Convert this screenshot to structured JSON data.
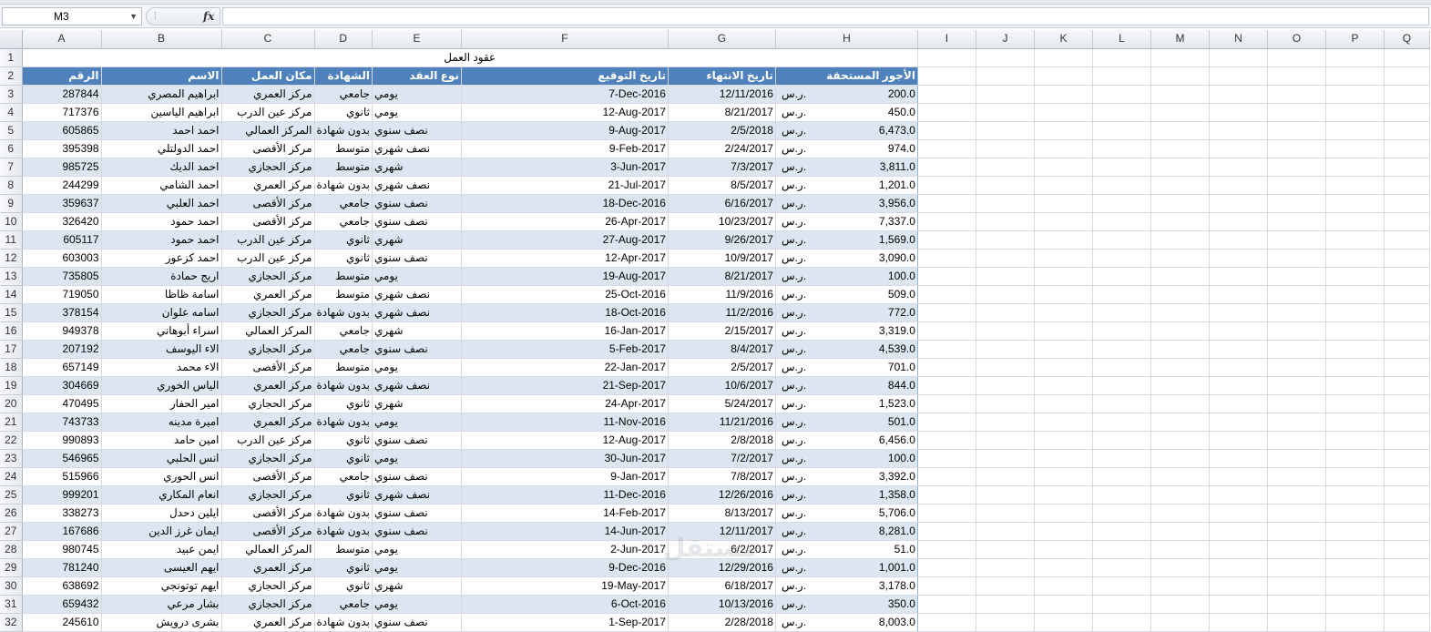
{
  "name_box": {
    "value": "M3"
  },
  "formula_bar": {
    "fx_label": "fx",
    "value": ""
  },
  "columns": [
    "A",
    "B",
    "C",
    "D",
    "E",
    "F",
    "G",
    "H",
    "I",
    "J",
    "K",
    "L",
    "M",
    "N",
    "O",
    "P",
    "Q"
  ],
  "title": "عقود العمل",
  "headers": {
    "A": "الرقم",
    "B": "الاسم",
    "C": "مكان العمل",
    "D": "الشهادة",
    "E": "نوع العقد",
    "F": "تاريخ التوقيع",
    "G": "تاريخ الانتهاء",
    "H": "الأجور المستحقة"
  },
  "currency_symbol": "ر.س.",
  "rows": [
    {
      "id": "287844",
      "name": "ابراهيم المصري",
      "place": "مركز العمري",
      "degree": "جامعي",
      "contract": "يومي",
      "sign": "7-Dec-2016",
      "end": "12/11/2016",
      "wage": "200.0"
    },
    {
      "id": "717376",
      "name": "ابراهيم الياسين",
      "place": "مركز عين الدرب",
      "degree": "ثانوي",
      "contract": "يومي",
      "sign": "12-Aug-2017",
      "end": "8/21/2017",
      "wage": "450.0"
    },
    {
      "id": "605865",
      "name": "احمد احمد",
      "place": "المركز العمالي",
      "degree": "بدون شهادة",
      "contract": "نصف سنوي",
      "sign": "9-Aug-2017",
      "end": "2/5/2018",
      "wage": "6,473.0"
    },
    {
      "id": "395398",
      "name": "احمد الدولتلي",
      "place": "مركز الأقصى",
      "degree": "متوسط",
      "contract": "نصف شهري",
      "sign": "9-Feb-2017",
      "end": "2/24/2017",
      "wage": "974.0"
    },
    {
      "id": "985725",
      "name": "احمد الديك",
      "place": "مركز الحجازي",
      "degree": "متوسط",
      "contract": "شهري",
      "sign": "3-Jun-2017",
      "end": "7/3/2017",
      "wage": "3,811.0"
    },
    {
      "id": "244299",
      "name": "احمد الشامي",
      "place": "مركز العمري",
      "degree": "بدون شهادة",
      "contract": "نصف شهري",
      "sign": "21-Jul-2017",
      "end": "8/5/2017",
      "wage": "1,201.0"
    },
    {
      "id": "359637",
      "name": "احمد العلبي",
      "place": "مركز الأقصى",
      "degree": "جامعي",
      "contract": "نصف سنوي",
      "sign": "18-Dec-2016",
      "end": "6/16/2017",
      "wage": "3,956.0"
    },
    {
      "id": "326420",
      "name": "احمد حمود",
      "place": "مركز الأقصى",
      "degree": "جامعي",
      "contract": "نصف سنوي",
      "sign": "26-Apr-2017",
      "end": "10/23/2017",
      "wage": "7,337.0"
    },
    {
      "id": "605117",
      "name": "احمد حمود",
      "place": "مركز عين الدرب",
      "degree": "ثانوي",
      "contract": "شهري",
      "sign": "27-Aug-2017",
      "end": "9/26/2017",
      "wage": "1,569.0"
    },
    {
      "id": "603003",
      "name": "احمد كزعور",
      "place": "مركز عين الدرب",
      "degree": "ثانوي",
      "contract": "نصف سنوي",
      "sign": "12-Apr-2017",
      "end": "10/9/2017",
      "wage": "3,090.0"
    },
    {
      "id": "735805",
      "name": "اريج حمادة",
      "place": "مركز الحجازي",
      "degree": "متوسط",
      "contract": "يومي",
      "sign": "19-Aug-2017",
      "end": "8/21/2017",
      "wage": "100.0"
    },
    {
      "id": "719050",
      "name": "اسامة ظاظا",
      "place": "مركز العمري",
      "degree": "متوسط",
      "contract": "نصف شهري",
      "sign": "25-Oct-2016",
      "end": "11/9/2016",
      "wage": "509.0"
    },
    {
      "id": "378154",
      "name": "اسامه علوان",
      "place": "مركز الحجازي",
      "degree": "بدون شهادة",
      "contract": "نصف شهري",
      "sign": "18-Oct-2016",
      "end": "11/2/2016",
      "wage": "772.0"
    },
    {
      "id": "949378",
      "name": "اسراء أبوهاني",
      "place": "المركز العمالي",
      "degree": "جامعي",
      "contract": "شهري",
      "sign": "16-Jan-2017",
      "end": "2/15/2017",
      "wage": "3,319.0"
    },
    {
      "id": "207192",
      "name": "الاء اليوسف",
      "place": "مركز الحجازي",
      "degree": "جامعي",
      "contract": "نصف سنوي",
      "sign": "5-Feb-2017",
      "end": "8/4/2017",
      "wage": "4,539.0"
    },
    {
      "id": "657149",
      "name": "الاء محمد",
      "place": "مركز الأقصى",
      "degree": "متوسط",
      "contract": "يومي",
      "sign": "22-Jan-2017",
      "end": "2/5/2017",
      "wage": "701.0"
    },
    {
      "id": "304669",
      "name": "الياس الخوري",
      "place": "مركز العمري",
      "degree": "بدون شهادة",
      "contract": "نصف شهري",
      "sign": "21-Sep-2017",
      "end": "10/6/2017",
      "wage": "844.0"
    },
    {
      "id": "470495",
      "name": "امير الحفار",
      "place": "مركز الحجازي",
      "degree": "ثانوي",
      "contract": "شهري",
      "sign": "24-Apr-2017",
      "end": "5/24/2017",
      "wage": "1,523.0"
    },
    {
      "id": "743733",
      "name": "اميرة مدينه",
      "place": "مركز العمري",
      "degree": "بدون شهادة",
      "contract": "يومي",
      "sign": "11-Nov-2016",
      "end": "11/21/2016",
      "wage": "501.0"
    },
    {
      "id": "990893",
      "name": "امين حامد",
      "place": "مركز عين الدرب",
      "degree": "ثانوي",
      "contract": "نصف سنوي",
      "sign": "12-Aug-2017",
      "end": "2/8/2018",
      "wage": "6,456.0"
    },
    {
      "id": "546965",
      "name": "انس الحلبي",
      "place": "مركز الحجازي",
      "degree": "ثانوي",
      "contract": "يومي",
      "sign": "30-Jun-2017",
      "end": "7/2/2017",
      "wage": "100.0"
    },
    {
      "id": "515966",
      "name": "انس الحوري",
      "place": "مركز الأقصى",
      "degree": "جامعي",
      "contract": "نصف سنوي",
      "sign": "9-Jan-2017",
      "end": "7/8/2017",
      "wage": "3,392.0"
    },
    {
      "id": "999201",
      "name": "انعام المكاري",
      "place": "مركز الحجازي",
      "degree": "ثانوي",
      "contract": "نصف شهري",
      "sign": "11-Dec-2016",
      "end": "12/26/2016",
      "wage": "1,358.0"
    },
    {
      "id": "338273",
      "name": "ايلين دحدل",
      "place": "مركز الأقصى",
      "degree": "بدون شهادة",
      "contract": "نصف سنوي",
      "sign": "14-Feb-2017",
      "end": "8/13/2017",
      "wage": "5,706.0"
    },
    {
      "id": "167686",
      "name": "ايمان غرز الدين",
      "place": "مركز الأقصى",
      "degree": "بدون شهادة",
      "contract": "نصف سنوي",
      "sign": "14-Jun-2017",
      "end": "12/11/2017",
      "wage": "8,281.0"
    },
    {
      "id": "980745",
      "name": "ايمن عبيد",
      "place": "المركز العمالي",
      "degree": "متوسط",
      "contract": "يومي",
      "sign": "2-Jun-2017",
      "end": "6/2/2017",
      "wage": "51.0"
    },
    {
      "id": "781240",
      "name": "ايهم العيسى",
      "place": "مركز العمري",
      "degree": "ثانوي",
      "contract": "يومي",
      "sign": "9-Dec-2016",
      "end": "12/29/2016",
      "wage": "1,001.0"
    },
    {
      "id": "638692",
      "name": "ايهم توتونجي",
      "place": "مركز الحجازي",
      "degree": "ثانوي",
      "contract": "شهري",
      "sign": "19-May-2017",
      "end": "6/18/2017",
      "wage": "3,178.0"
    },
    {
      "id": "659432",
      "name": "بشار مرعي",
      "place": "مركز الحجازي",
      "degree": "جامعي",
      "contract": "يومي",
      "sign": "6-Oct-2016",
      "end": "10/13/2016",
      "wage": "350.0"
    },
    {
      "id": "245610",
      "name": "بشرى درويش",
      "place": "مركز العمري",
      "degree": "بدون شهادة",
      "contract": "نصف سنوي",
      "sign": "1-Sep-2017",
      "end": "2/28/2018",
      "wage": "8,003.0"
    }
  ],
  "colors": {
    "header_blue": "#4f81bd",
    "band_blue": "#dce6f1",
    "border_blue": "#95b3d7"
  }
}
